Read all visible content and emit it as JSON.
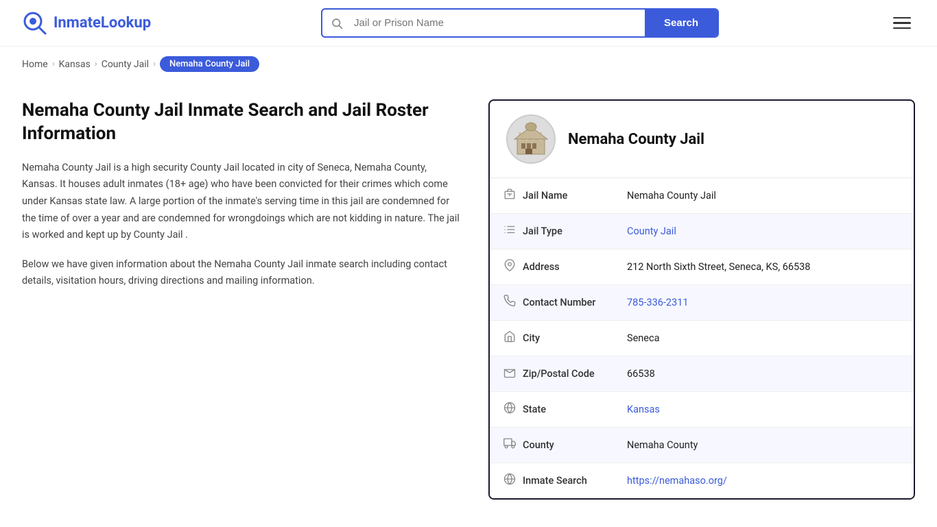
{
  "header": {
    "logo_text_part1": "Inmate",
    "logo_text_part2": "Lookup",
    "search_placeholder": "Jail or Prison Name",
    "search_button_label": "Search"
  },
  "breadcrumb": {
    "home": "Home",
    "state": "Kansas",
    "category": "County Jail",
    "current": "Nemaha County Jail"
  },
  "left": {
    "title": "Nemaha County Jail Inmate Search and Jail Roster Information",
    "desc1": "Nemaha County Jail is a high security County Jail located in city of Seneca, Nemaha County, Kansas. It houses adult inmates (18+ age) who have been convicted for their crimes which come under Kansas state law. A large portion of the inmate's serving time in this jail are condemned for the time of over a year and are condemned for wrongdoings which are not kidding in nature. The jail is worked and kept up by County Jail .",
    "desc2": "Below we have given information about the Nemaha County Jail inmate search including contact details, visitation hours, driving directions and mailing information."
  },
  "jail_card": {
    "name": "Nemaha County Jail",
    "rows": [
      {
        "icon": "building-icon",
        "label": "Jail Name",
        "value": "Nemaha County Jail",
        "link": null
      },
      {
        "icon": "list-icon",
        "label": "Jail Type",
        "value": "County Jail",
        "link": "#"
      },
      {
        "icon": "pin-icon",
        "label": "Address",
        "value": "212 North Sixth Street, Seneca, KS, 66538",
        "link": null
      },
      {
        "icon": "phone-icon",
        "label": "Contact Number",
        "value": "785-336-2311",
        "link": "#"
      },
      {
        "icon": "city-icon",
        "label": "City",
        "value": "Seneca",
        "link": null
      },
      {
        "icon": "mail-icon",
        "label": "Zip/Postal Code",
        "value": "66538",
        "link": null
      },
      {
        "icon": "globe-icon",
        "label": "State",
        "value": "Kansas",
        "link": "#"
      },
      {
        "icon": "county-icon",
        "label": "County",
        "value": "Nemaha County",
        "link": null
      },
      {
        "icon": "search-globe-icon",
        "label": "Inmate Search",
        "value": "https://nemahaso.org/",
        "link": "https://nemahaso.org/"
      }
    ]
  }
}
